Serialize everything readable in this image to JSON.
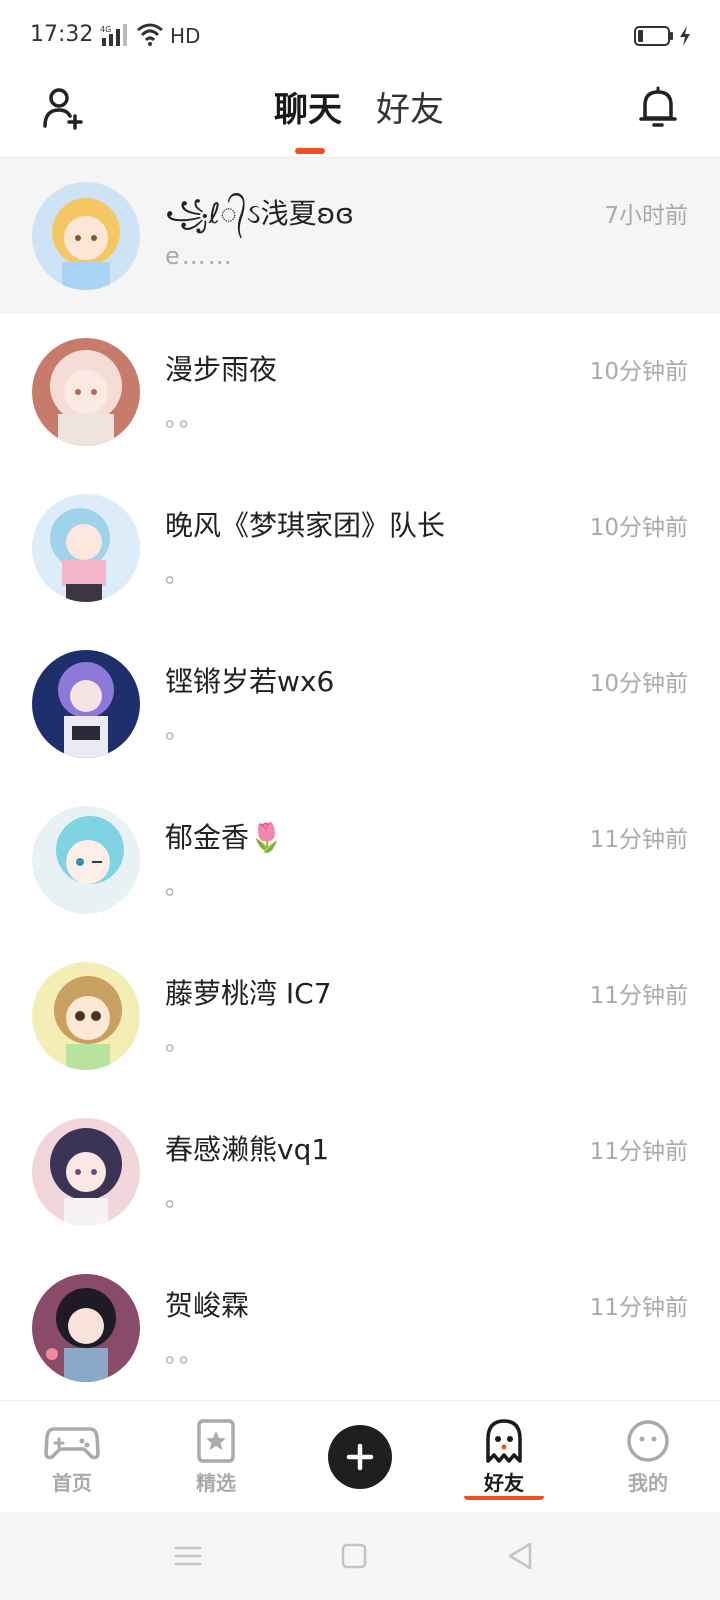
{
  "status_bar": {
    "time": "17:32",
    "network": "4G",
    "hd": "HD"
  },
  "header": {
    "tabs": [
      {
        "label": "聊天",
        "active": true
      },
      {
        "label": "好友",
        "active": false
      }
    ],
    "accent_color": "#f0501e"
  },
  "chats": [
    {
      "name": "꧁ℓ᭄ઽ浅夏ʚɞ",
      "time": "7小时前",
      "preview": "e……",
      "highlighted": true
    },
    {
      "name": "漫步雨夜",
      "time": "10分钟前",
      "preview": "。。"
    },
    {
      "name": "晚风《梦琪家团》队长",
      "time": "10分钟前",
      "preview": "。"
    },
    {
      "name": "铿锵岁若wx6",
      "time": "10分钟前",
      "preview": "。"
    },
    {
      "name": "郁金香🌷",
      "time": "11分钟前",
      "preview": "。"
    },
    {
      "name": "藤萝桃湾 IC7",
      "time": "11分钟前",
      "preview": "。"
    },
    {
      "name": "春感濑熊vq1",
      "time": "11分钟前",
      "preview": "。"
    },
    {
      "name": "贺峻霖",
      "time": "11分钟前",
      "preview": "。。"
    }
  ],
  "tab_bar": {
    "items": [
      {
        "label": "首页",
        "icon": "gamepad-icon",
        "active": false
      },
      {
        "label": "精选",
        "icon": "star-bookmark-icon",
        "active": false
      },
      {
        "label": "好友",
        "icon": "ghost-icon",
        "active": true
      },
      {
        "label": "我的",
        "icon": "smiley-icon",
        "active": false
      }
    ],
    "center_icon": "plus-icon"
  },
  "system_nav": {
    "icons": [
      "menu-icon",
      "home-square-icon",
      "back-triangle-icon"
    ]
  }
}
